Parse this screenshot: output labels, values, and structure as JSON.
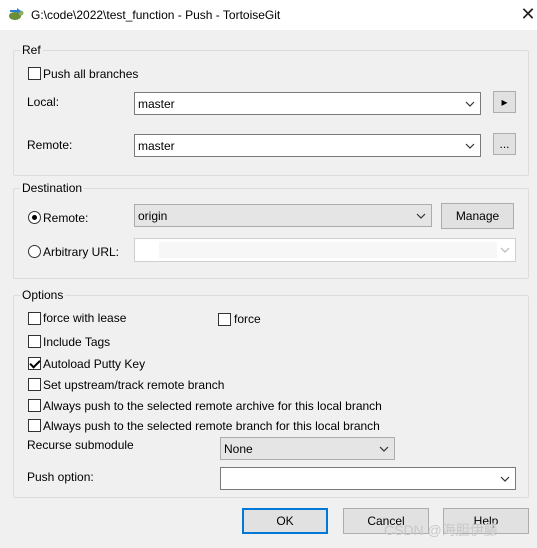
{
  "window": {
    "title": "G:\\code\\2022\\test_function - Push - TortoiseGit",
    "close_glyph": "✕"
  },
  "ref": {
    "group_title": "Ref",
    "push_all_branches": {
      "label": "Push all branches",
      "checked": false
    },
    "local": {
      "label": "Local:",
      "value": "master",
      "side_button": "▸"
    },
    "remote": {
      "label": "Remote:",
      "value": "master",
      "side_button": "..."
    }
  },
  "destination": {
    "group_title": "Destination",
    "remote": {
      "label": "Remote:",
      "value": "origin",
      "selected": true
    },
    "manage_label": "Manage",
    "arbitrary_url": {
      "label": "Arbitrary URL:",
      "value": "",
      "selected": false
    }
  },
  "options": {
    "group_title": "Options",
    "force_with_lease": {
      "label": "force with lease",
      "checked": false
    },
    "force": {
      "label": "force",
      "checked": false
    },
    "include_tags": {
      "label": "Include Tags",
      "checked": false
    },
    "autoload_putty_key": {
      "label": "Autoload Putty Key",
      "checked": true
    },
    "set_upstream": {
      "label": "Set upstream/track remote branch",
      "checked": false
    },
    "always_push_archive": {
      "label": "Always push to the selected remote archive for this local branch",
      "checked": false
    },
    "always_push_branch": {
      "label": "Always push to the selected remote branch for this local branch",
      "checked": false
    },
    "recurse_submodule": {
      "label": "Recurse submodule",
      "value": "None"
    },
    "push_option": {
      "label": "Push option:",
      "value": ""
    }
  },
  "buttons": {
    "ok": "OK",
    "cancel": "Cancel",
    "help": "Help"
  },
  "watermark": "CSDN @海胆伊藤",
  "icons": {
    "app": "tortoisegit-push-icon",
    "dropdown": "chevron-down-icon",
    "close": "close-icon"
  },
  "colors": {
    "default_button_border": "#0078d7",
    "dialog_bg": "#f0f0f0"
  }
}
